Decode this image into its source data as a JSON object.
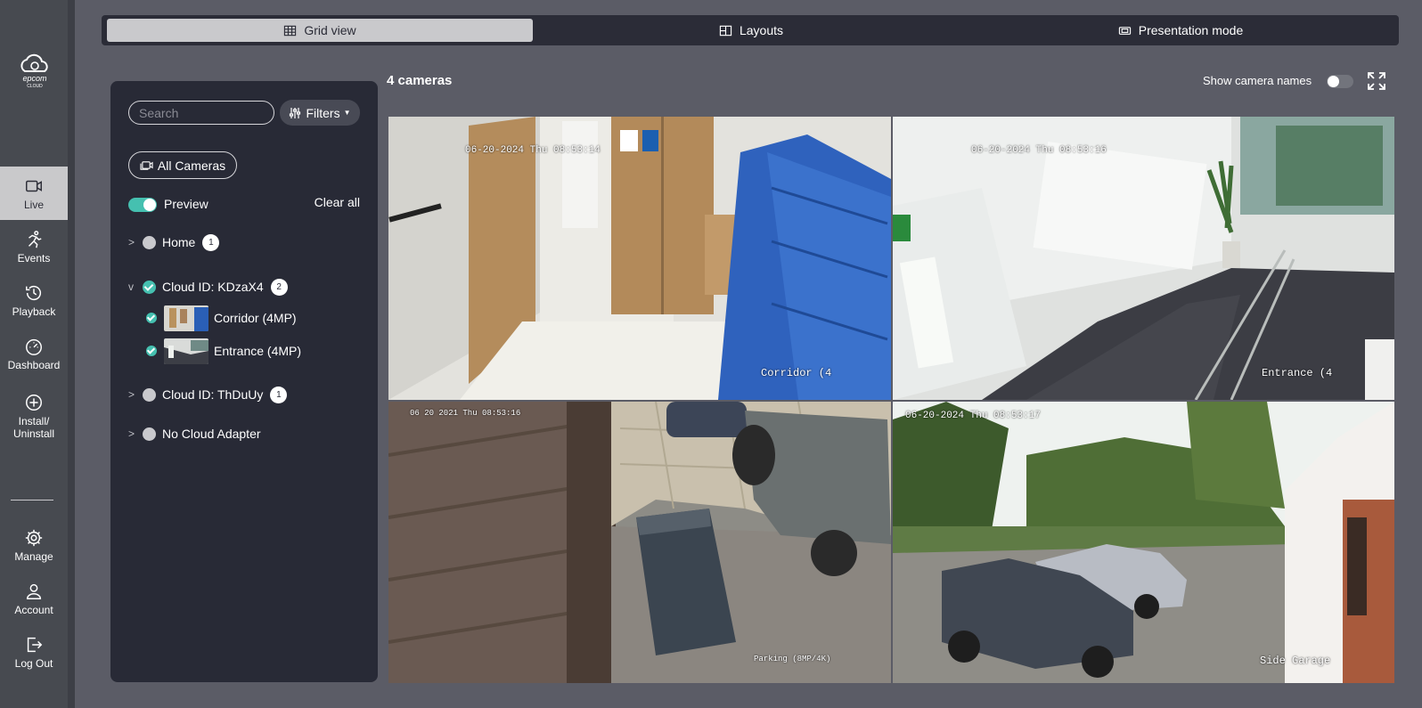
{
  "nav": {
    "items": [
      {
        "label": "Live",
        "icon": "camera-icon"
      },
      {
        "label": "Events",
        "icon": "running-person-icon"
      },
      {
        "label": "Playback",
        "icon": "history-icon"
      },
      {
        "label": "Dashboard",
        "icon": "gauge-icon"
      },
      {
        "label": "Install/",
        "label2": "Uninstall",
        "icon": "plus-circle-icon"
      },
      {
        "label": "Manage",
        "icon": "gear-icon"
      },
      {
        "label": "Account",
        "icon": "person-icon"
      },
      {
        "label": "Log Out",
        "icon": "logout-icon"
      }
    ],
    "logo_text": "epcom",
    "logo_sub": "CLOUD"
  },
  "tabs": [
    {
      "label": "Grid view",
      "icon": "grid-icon",
      "active": true
    },
    {
      "label": "Layouts",
      "icon": "layout-icon",
      "active": false
    },
    {
      "label": "Presentation mode",
      "icon": "presentation-icon",
      "active": false
    }
  ],
  "panel": {
    "search_placeholder": "Search",
    "filters_label": "Filters",
    "all_cameras_label": "All Cameras",
    "preview_label": "Preview",
    "preview_on": true,
    "clear_all_label": "Clear all",
    "groups": [
      {
        "name": "Home",
        "count": "1",
        "expanded": false,
        "checked": false
      },
      {
        "name": "Cloud ID: KDzaX4",
        "count": "2",
        "expanded": true,
        "checked": true,
        "cameras": [
          {
            "name": "Corridor (4MP)",
            "checked": true
          },
          {
            "name": "Entrance (4MP)",
            "checked": true
          }
        ]
      },
      {
        "name": "Cloud ID: ThDuUy",
        "count": "1",
        "expanded": false,
        "checked": false
      },
      {
        "name": "No Cloud Adapter",
        "count": "",
        "expanded": false,
        "checked": false
      }
    ]
  },
  "main": {
    "camera_count": "4 cameras",
    "show_names_label": "Show camera names",
    "show_names_on": false,
    "tiles": [
      {
        "osd": "06-20-2024 Thu 08:53:14",
        "label": "Corridor (4"
      },
      {
        "osd": "06-20-2024 Thu 08:53:16",
        "label": "Entrance (4"
      },
      {
        "osd": "06 20 2021 Thu 08:53:16",
        "label": "Parking (8MP/4K)"
      },
      {
        "osd": "06-20-2024 Thu 08:53:17",
        "label": "Side Garage"
      }
    ]
  }
}
